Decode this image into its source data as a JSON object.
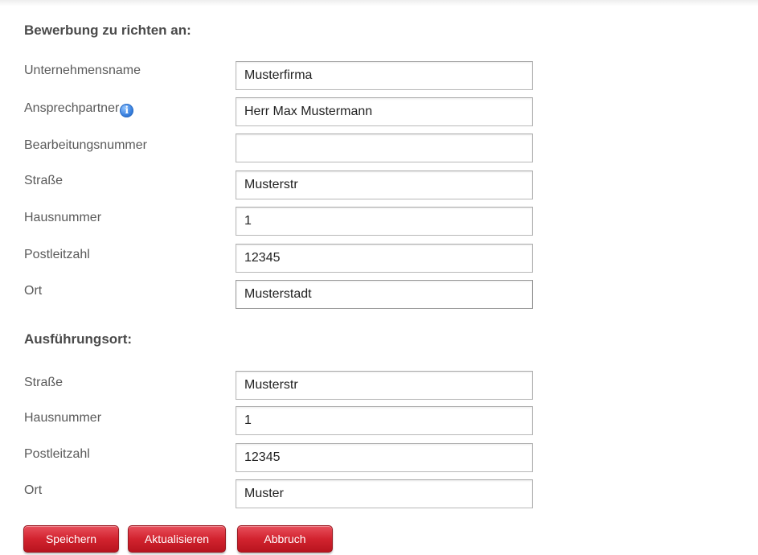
{
  "sections": {
    "recipient": {
      "heading": "Bewerbung zu richten an:",
      "fields": {
        "company": {
          "label": "Unternehmensname",
          "value": "Musterfirma"
        },
        "contact": {
          "label": "Ansprechpartner",
          "value": "Herr Max Mustermann",
          "info_icon": "info-icon"
        },
        "reference": {
          "label": "Bearbeitungsnummer",
          "value": ""
        },
        "street": {
          "label": "Straße",
          "value": "Musterstr"
        },
        "house_number": {
          "label": "Hausnummer",
          "value": "1"
        },
        "postal_code": {
          "label": "Postleitzahl",
          "value": "12345"
        },
        "city": {
          "label": "Ort",
          "value": "Musterstadt"
        }
      }
    },
    "location": {
      "heading": "Ausführungsort:",
      "fields": {
        "street": {
          "label": "Straße",
          "value": "Musterstr"
        },
        "house_number": {
          "label": "Hausnummer",
          "value": "1"
        },
        "postal_code": {
          "label": "Postleitzahl",
          "value": "12345"
        },
        "city": {
          "label": "Ort",
          "value": "Muster"
        }
      }
    }
  },
  "buttons": {
    "save": "Speichern",
    "update": "Aktualisieren",
    "cancel": "Abbruch"
  },
  "colors": {
    "button_red": "#d2232f",
    "info_blue": "#3b82e0"
  }
}
